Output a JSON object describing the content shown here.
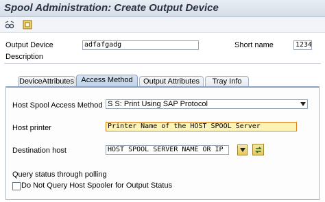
{
  "window": {
    "title": "Spool Administration: Create Output Device"
  },
  "toolbar": {
    "items": [
      {
        "icon": "glasses-toggle-icon"
      },
      {
        "icon": "settings-icon"
      }
    ]
  },
  "header": {
    "output_device_label": "Output Device",
    "output_device_value": "adfafgadg",
    "short_name_label": "Short name",
    "short_name_value": "1234",
    "description_label": "Description"
  },
  "tabs": [
    {
      "label": "DeviceAttributes",
      "active": false
    },
    {
      "label": "Access Method",
      "active": true
    },
    {
      "label": "Output Attributes",
      "active": false
    },
    {
      "label": "Tray Info",
      "active": false
    }
  ],
  "access_method": {
    "host_spool_label": "Host Spool Access Method",
    "host_spool_value": "S S: Print Using SAP Protocol",
    "host_printer_label": "Host printer",
    "host_printer_value": "Printer Name of the HOST SPOOL Server",
    "destination_host_label": "Destination host",
    "destination_host_value": "HOST SPOOL SERVER NAME OR IP",
    "query_status_label": "Query status through polling",
    "no_query_checkbox_label": "Do Not Query Host Spooler for Output Status",
    "no_query_checked": false
  },
  "colors": {
    "highlight_field": "#fdf3b5",
    "highlight_border": "#e0821b",
    "title_text": "#2b3340",
    "tab_active": "#c7d8ee"
  }
}
